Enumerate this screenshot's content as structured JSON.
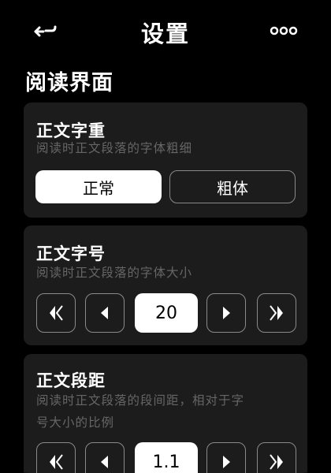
{
  "header": {
    "title": "设置",
    "back_icon": "back-arrow-icon",
    "more_icon": "more-dots-icon"
  },
  "section": {
    "title": "阅读界面"
  },
  "font_weight": {
    "title": "正文字重",
    "description": "阅读时正文段落的字体粗细",
    "options": [
      "正常",
      "粗体"
    ],
    "selected": "正常"
  },
  "font_size": {
    "title": "正文字号",
    "description": "阅读时正文段落的字体大小",
    "value": "20"
  },
  "paragraph_spacing": {
    "title": "正文段距",
    "description_line1": "阅读时正文段落的段间距，相对于字",
    "description_line2": "号大小的比例",
    "value": "1.1"
  },
  "colors": {
    "background": "#000000",
    "card": "#1c1c1c",
    "muted_text": "#666666",
    "border": "#8a8a8a",
    "active": "#ffffff"
  }
}
